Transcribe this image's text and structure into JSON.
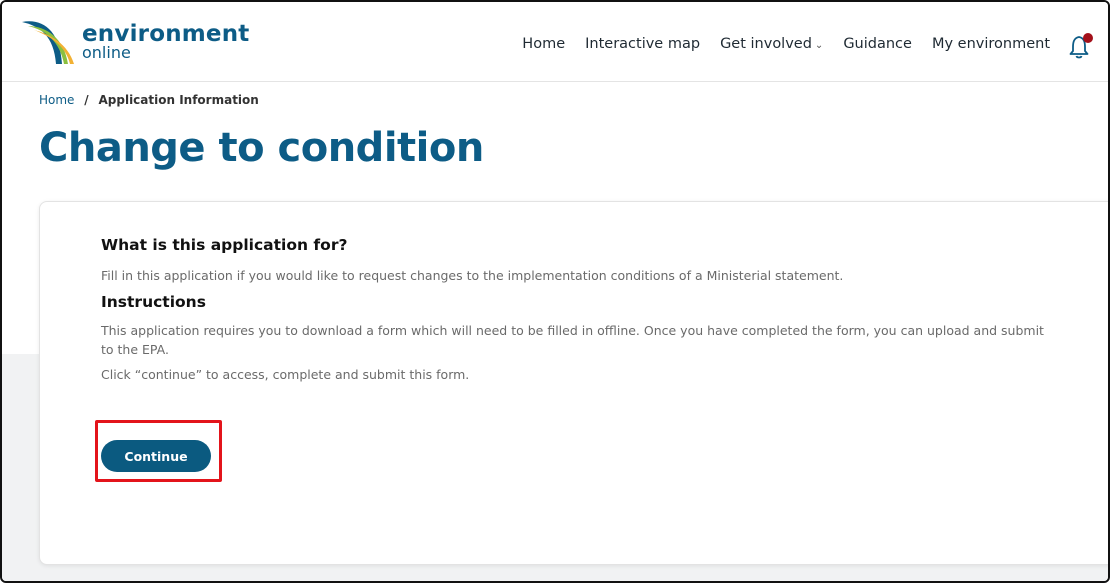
{
  "header": {
    "logo": {
      "main": "environment",
      "sub": "online"
    },
    "nav": [
      {
        "label": "Home"
      },
      {
        "label": "Interactive map"
      },
      {
        "label": "Get involved",
        "has_caret": true
      },
      {
        "label": "Guidance"
      },
      {
        "label": "My environment"
      }
    ],
    "notification": {
      "icon": "bell-icon",
      "badge_color": "#a3101a"
    }
  },
  "breadcrumb": {
    "items": [
      {
        "label": "Home",
        "link": true
      },
      {
        "label": "Application Information",
        "link": false
      }
    ],
    "separator": "/"
  },
  "page": {
    "title": "Change to condition"
  },
  "card": {
    "heading_purpose": "What is this application for?",
    "text_purpose": "Fill in this application if you would like to request changes to the implementation conditions of a Ministerial statement.",
    "heading_instructions": "Instructions",
    "text_instructions_1": "This application requires you to download a form which will need to be filled in offline. Once you have completed the form, you can upload and submit to the EPA.",
    "text_instructions_2": "Click “continue” to access, complete and submit this form.",
    "continue_label": "Continue"
  },
  "colors": {
    "brand": "#0d5c86",
    "button": "#0b5a80",
    "highlight": "#e3141b"
  }
}
